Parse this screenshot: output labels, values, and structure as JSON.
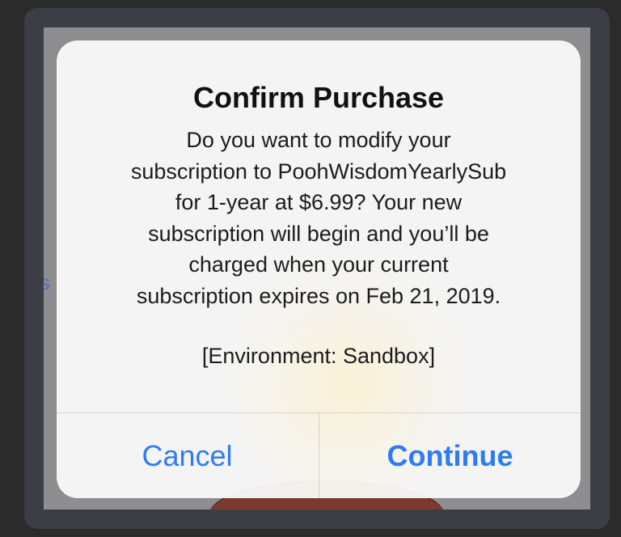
{
  "background": {
    "partial_text": "s"
  },
  "alert": {
    "title": "Confirm Purchase",
    "message_lines": [
      "Do you want to modify your",
      "subscription to PoohWisdomYearlySub",
      "for 1-year at $6.99? Your new",
      "subscription will begin and you’ll be",
      "charged when your current",
      "subscription expires on Feb 21, 2019."
    ],
    "environment": "[Environment: Sandbox]",
    "buttons": {
      "cancel": "Cancel",
      "continue": "Continue"
    }
  },
  "colors": {
    "accent": "#2f7bf5",
    "frame": "#3b3f45",
    "page_bg": "#2b2b2b"
  }
}
